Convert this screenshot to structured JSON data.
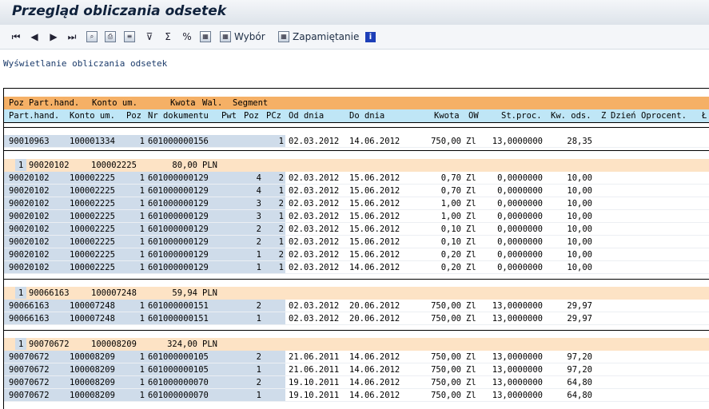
{
  "title": "Przegląd obliczania odsetek",
  "toolbar": {
    "wybor": "Wybór",
    "zapamietanie": "Zapamiętanie"
  },
  "subtitle": "Wyświetlanie obliczania odsetek",
  "header1": {
    "poz": "Poz",
    "partner": "Part.hand.",
    "konto": "Konto um.",
    "kwota": "Kwota",
    "waluta": "Wal.",
    "segment": "Segment"
  },
  "header2": {
    "partner": "Part.hand.",
    "konto": "Konto um.",
    "poz": "Poz",
    "nr": "Nr dokumentu",
    "pwt": "Pwt",
    "poz2": "Poz",
    "pcz": "PCz",
    "od": "Od dnia",
    "do": "Do dnia",
    "kwota": "Kwota",
    "ow": "OW",
    "stproc": "St.proc.",
    "kwods": "Kw. ods.",
    "z": "Z",
    "dzien": "Dzień",
    "oprocent": "Oprocent.",
    "last": "Ł"
  },
  "single_row": {
    "partner": "90010963",
    "konto": "100001334",
    "poz": "1",
    "nr": "601000000156",
    "pwt": "",
    "poz2": "1",
    "pcz": "",
    "od": "02.03.2012",
    "do": "14.06.2012",
    "kwota": "750,00",
    "ow": "Zl",
    "stproc": "13,0000000",
    "kwods": "28,35"
  },
  "groups": [
    {
      "poz": "1",
      "partner": "90020102",
      "konto": "100002225",
      "kwota": "80,00",
      "waluta": "PLN",
      "rows": [
        {
          "partner": "90020102",
          "konto": "100002225",
          "poz": "1",
          "nr": "601000000129",
          "pwt": "4",
          "poz2": "2",
          "od": "02.03.2012",
          "do": "15.06.2012",
          "kwota": "0,70",
          "ow": "Zl",
          "stproc": "0,0000000",
          "kwods": "10,00"
        },
        {
          "partner": "90020102",
          "konto": "100002225",
          "poz": "1",
          "nr": "601000000129",
          "pwt": "4",
          "poz2": "1",
          "od": "02.03.2012",
          "do": "15.06.2012",
          "kwota": "0,70",
          "ow": "Zl",
          "stproc": "0,0000000",
          "kwods": "10,00"
        },
        {
          "partner": "90020102",
          "konto": "100002225",
          "poz": "1",
          "nr": "601000000129",
          "pwt": "3",
          "poz2": "2",
          "od": "02.03.2012",
          "do": "15.06.2012",
          "kwota": "1,00",
          "ow": "Zl",
          "stproc": "0,0000000",
          "kwods": "10,00"
        },
        {
          "partner": "90020102",
          "konto": "100002225",
          "poz": "1",
          "nr": "601000000129",
          "pwt": "3",
          "poz2": "1",
          "od": "02.03.2012",
          "do": "15.06.2012",
          "kwota": "1,00",
          "ow": "Zl",
          "stproc": "0,0000000",
          "kwods": "10,00"
        },
        {
          "partner": "90020102",
          "konto": "100002225",
          "poz": "1",
          "nr": "601000000129",
          "pwt": "2",
          "poz2": "2",
          "od": "02.03.2012",
          "do": "15.06.2012",
          "kwota": "0,10",
          "ow": "Zl",
          "stproc": "0,0000000",
          "kwods": "10,00"
        },
        {
          "partner": "90020102",
          "konto": "100002225",
          "poz": "1",
          "nr": "601000000129",
          "pwt": "2",
          "poz2": "1",
          "od": "02.03.2012",
          "do": "15.06.2012",
          "kwota": "0,10",
          "ow": "Zl",
          "stproc": "0,0000000",
          "kwods": "10,00"
        },
        {
          "partner": "90020102",
          "konto": "100002225",
          "poz": "1",
          "nr": "601000000129",
          "pwt": "1",
          "poz2": "2",
          "od": "02.03.2012",
          "do": "15.06.2012",
          "kwota": "0,20",
          "ow": "Zl",
          "stproc": "0,0000000",
          "kwods": "10,00"
        },
        {
          "partner": "90020102",
          "konto": "100002225",
          "poz": "1",
          "nr": "601000000129",
          "pwt": "1",
          "poz2": "1",
          "od": "02.03.2012",
          "do": "14.06.2012",
          "kwota": "0,20",
          "ow": "Zl",
          "stproc": "0,0000000",
          "kwods": "10,00"
        }
      ]
    },
    {
      "poz": "1",
      "partner": "90066163",
      "konto": "100007248",
      "kwota": "59,94",
      "waluta": "PLN",
      "rows": [
        {
          "partner": "90066163",
          "konto": "100007248",
          "poz": "1",
          "nr": "601000000151",
          "pwt": "2",
          "poz2": "",
          "od": "02.03.2012",
          "do": "20.06.2012",
          "kwota": "750,00",
          "ow": "Zl",
          "stproc": "13,0000000",
          "kwods": "29,97"
        },
        {
          "partner": "90066163",
          "konto": "100007248",
          "poz": "1",
          "nr": "601000000151",
          "pwt": "1",
          "poz2": "",
          "od": "02.03.2012",
          "do": "20.06.2012",
          "kwota": "750,00",
          "ow": "Zl",
          "stproc": "13,0000000",
          "kwods": "29,97"
        }
      ]
    },
    {
      "poz": "1",
      "partner": "90070672",
      "konto": "100008209",
      "kwota": "324,00",
      "waluta": "PLN",
      "rows": [
        {
          "partner": "90070672",
          "konto": "100008209",
          "poz": "1",
          "nr": "601000000105",
          "pwt": "2",
          "poz2": "",
          "od": "21.06.2011",
          "do": "14.06.2012",
          "kwota": "750,00",
          "ow": "Zl",
          "stproc": "13,0000000",
          "kwods": "97,20"
        },
        {
          "partner": "90070672",
          "konto": "100008209",
          "poz": "1",
          "nr": "601000000105",
          "pwt": "1",
          "poz2": "",
          "od": "21.06.2011",
          "do": "14.06.2012",
          "kwota": "750,00",
          "ow": "Zl",
          "stproc": "13,0000000",
          "kwods": "97,20"
        },
        {
          "partner": "90070672",
          "konto": "100008209",
          "poz": "1",
          "nr": "601000000070",
          "pwt": "2",
          "poz2": "",
          "od": "19.10.2011",
          "do": "14.06.2012",
          "kwota": "750,00",
          "ow": "Zl",
          "stproc": "13,0000000",
          "kwods": "64,80"
        },
        {
          "partner": "90070672",
          "konto": "100008209",
          "poz": "1",
          "nr": "601000000070",
          "pwt": "1",
          "poz2": "",
          "od": "19.10.2011",
          "do": "14.06.2012",
          "kwota": "750,00",
          "ow": "Zl",
          "stproc": "13,0000000",
          "kwods": "64,80"
        }
      ]
    }
  ]
}
